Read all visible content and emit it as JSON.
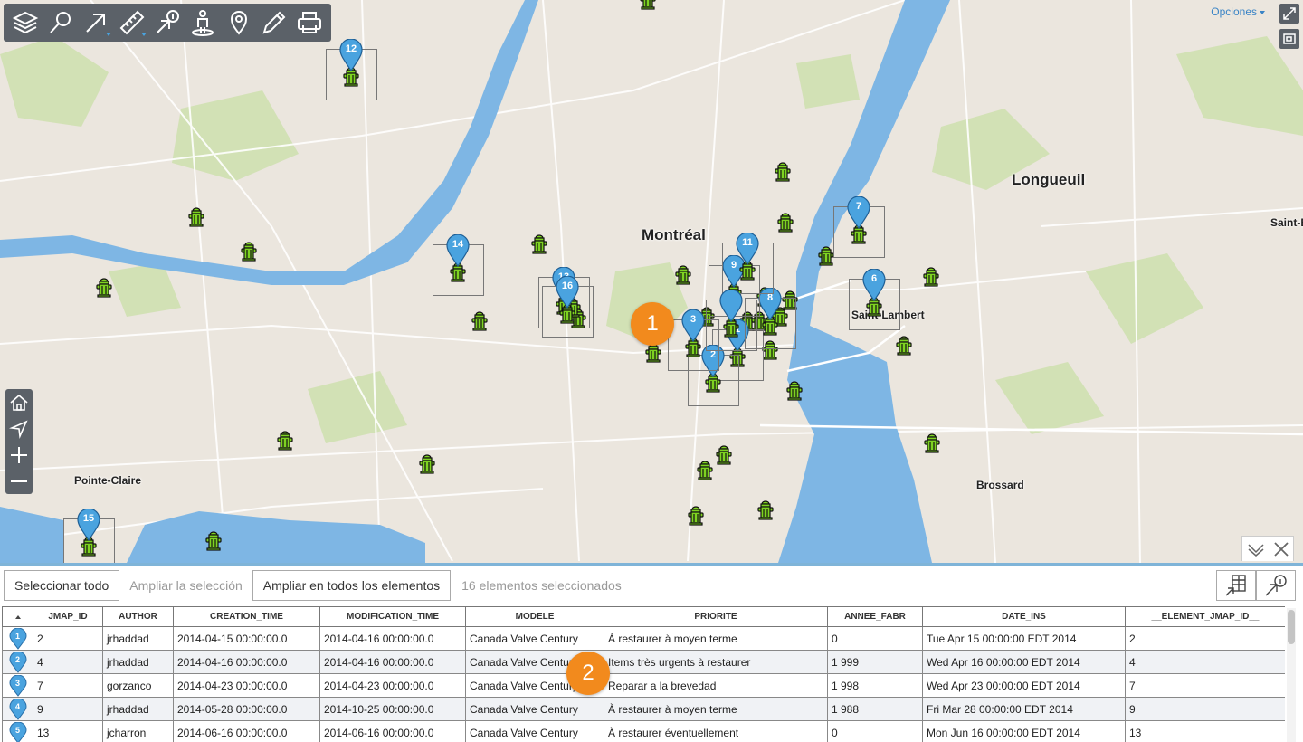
{
  "toolbar": {
    "buttons": [
      {
        "name": "layers-button",
        "icon": "layers-icon"
      },
      {
        "name": "search-button",
        "icon": "magnifier-icon"
      },
      {
        "name": "select-arrow-button",
        "icon": "arrow-select-icon"
      },
      {
        "name": "measure-button",
        "icon": "ruler-icon"
      },
      {
        "name": "info-select-button",
        "icon": "arrow-info-icon"
      },
      {
        "name": "street-view-button",
        "icon": "person-icon"
      },
      {
        "name": "locate-button",
        "icon": "map-pin-icon"
      },
      {
        "name": "edit-button",
        "icon": "pencil-ruler-icon"
      },
      {
        "name": "print-button",
        "icon": "printer-icon"
      }
    ]
  },
  "map": {
    "options_label": "Opciones",
    "places": {
      "montreal": "Montréal",
      "longueuil": "Longueuil",
      "saint_lambert": "Saint-Lambert",
      "saint_b": "Saint-B",
      "pointe_claire": "Pointe-Claire",
      "brossard": "Brossard"
    },
    "pins": [
      "1",
      "2",
      "3",
      "5",
      "6",
      "7",
      "8",
      "9",
      "11",
      "12",
      "13",
      "14",
      "15",
      "16"
    ],
    "callouts": {
      "one": "1",
      "two": "2"
    },
    "accent": "#4aa3df",
    "callout_color": "#f28a1d"
  },
  "panel": {
    "select_all": "Seleccionar todo",
    "zoom_selection": "Ampliar la selección",
    "zoom_all": "Ampliar en todos los elementos",
    "count_text": "16 elementos seleccionados",
    "columns": [
      "JMAP_ID",
      "AUTHOR",
      "CREATION_TIME",
      "MODIFICATION_TIME",
      "MODELE",
      "PRIORITE",
      "ANNEE_FABR",
      "DATE_INS",
      "__ELEMENT_JMAP_ID__"
    ],
    "rows": [
      {
        "pin": "1",
        "cells": [
          "2",
          "jrhaddad",
          "2014-04-15 00:00:00.0",
          "2014-04-16 00:00:00.0",
          "Canada Valve Century",
          "À restaurer à moyen terme",
          "0",
          "Tue Apr 15 00:00:00 EDT 2014",
          "2"
        ]
      },
      {
        "pin": "2",
        "cells": [
          "4",
          "jrhaddad",
          "2014-04-16 00:00:00.0",
          "2014-04-16 00:00:00.0",
          "Canada Valve Century",
          "Items très urgents à restaurer",
          "1 999",
          "Wed Apr 16 00:00:00 EDT 2014",
          "4"
        ]
      },
      {
        "pin": "3",
        "cells": [
          "7",
          "gorzanco",
          "2014-04-23 00:00:00.0",
          "2014-04-23 00:00:00.0",
          "Canada Valve Century",
          "Reparar a la brevedad",
          "1 998",
          "Wed Apr 23 00:00:00 EDT 2014",
          "7"
        ]
      },
      {
        "pin": "4",
        "cells": [
          "9",
          "jrhaddad",
          "2014-05-28 00:00:00.0",
          "2014-10-25 00:00:00.0",
          "Canada Valve Century",
          "À restaurer à moyen terme",
          "1 988",
          "Fri Mar 28 00:00:00 EDT 2014",
          "9"
        ]
      },
      {
        "pin": "5",
        "cells": [
          "13",
          "jcharron",
          "2014-06-16 00:00:00.0",
          "2014-06-16 00:00:00.0",
          "Canada Valve Century",
          "À restaurer éventuellement",
          "0",
          "Mon Jun 16 00:00:00 EDT 2014",
          "13"
        ]
      }
    ]
  }
}
